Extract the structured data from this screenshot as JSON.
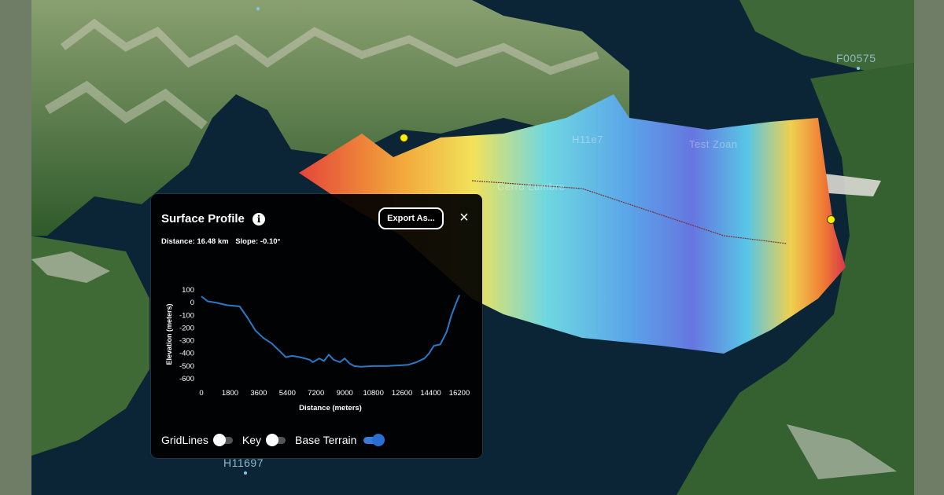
{
  "map": {
    "labels": [
      "F00575",
      "H11697",
      "Test Zoan",
      "H11e7",
      "Cerro Lumbre"
    ],
    "colors": {
      "water": "#0b2436",
      "land": "#3f6b34",
      "snow": "#d7d5c8"
    }
  },
  "panel": {
    "title": "Surface Profile",
    "info_icon": "i",
    "export_label": "Export As...",
    "close_icon": "×",
    "distance": "Distance: 16.48 km",
    "slope": "Slope: -0.10°"
  },
  "toggles": [
    {
      "label": "GridLines",
      "on": false
    },
    {
      "label": "Key",
      "on": false
    },
    {
      "label": "Base Terrain",
      "on": true
    }
  ],
  "chart_data": {
    "type": "line",
    "xlabel": "Distance (meters)",
    "ylabel": "Elevation (meters)",
    "xlim": [
      0,
      16200
    ],
    "ylim": [
      -600,
      100
    ],
    "x_ticks": [
      "0",
      "1800",
      "3600",
      "5400",
      "7200",
      "9000",
      "10800",
      "12600",
      "14400",
      "16200"
    ],
    "y_ticks": [
      "100",
      "0",
      "-100",
      "-200",
      "-300",
      "-400",
      "-500",
      "-600"
    ],
    "series": [
      {
        "color": "#2a79c4",
        "x": [
          0,
          400,
          900,
          1600,
          2400,
          2900,
          3400,
          3900,
          4400,
          4900,
          5300,
          5700,
          6200,
          6800,
          7000,
          7400,
          7700,
          8000,
          8300,
          8700,
          9000,
          9300,
          9600,
          10000,
          10800,
          11600,
          12400,
          13000,
          13500,
          14000,
          14300,
          14600,
          15000,
          15400,
          15700,
          16000,
          16200
        ],
        "y": [
          50,
          10,
          0,
          -20,
          -30,
          -120,
          -220,
          -280,
          -320,
          -380,
          -430,
          -420,
          -430,
          -450,
          -470,
          -440,
          -460,
          -410,
          -450,
          -470,
          -440,
          -480,
          -500,
          -505,
          -500,
          -500,
          -495,
          -490,
          -470,
          -440,
          -400,
          -340,
          -330,
          -230,
          -100,
          0,
          60
        ]
      }
    ]
  }
}
